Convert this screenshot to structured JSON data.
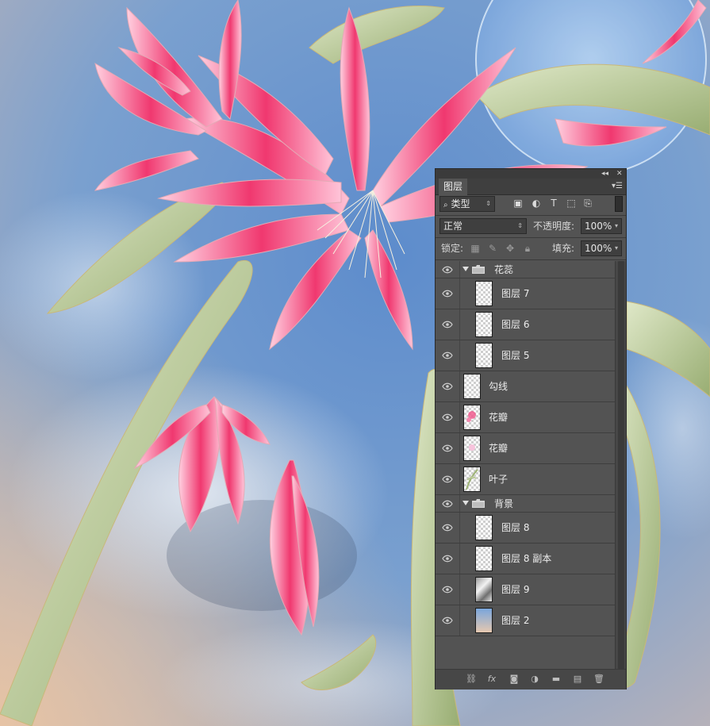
{
  "panel": {
    "tab_title": "图层",
    "collapse_icon": "double-chevron-left-icon",
    "close_icon": "close-icon",
    "menu_icon": "panel-menu-icon",
    "filter": {
      "search_icon": "search-icon",
      "value": "类型"
    },
    "filter_icons": [
      "image-filter-icon",
      "adjustment-filter-icon",
      "text-filter-icon",
      "shape-filter-icon",
      "smart-object-filter-icon"
    ],
    "blend_mode": "正常",
    "opacity_label": "不透明度:",
    "opacity_value": "100%",
    "lock_label": "锁定:",
    "lock_icons": [
      "lock-transparent-icon",
      "lock-paint-icon",
      "lock-position-icon",
      "lock-all-icon"
    ],
    "fill_label": "填充:",
    "fill_value": "100%",
    "layers": [
      {
        "name": "花蕊",
        "kind": "group",
        "expanded": true,
        "indent": 0
      },
      {
        "name": "图层 7",
        "kind": "layer",
        "indent": 1,
        "thumb": "transparent"
      },
      {
        "name": "图层 6",
        "kind": "layer",
        "indent": 1,
        "thumb": "transparent"
      },
      {
        "name": "图层 5",
        "kind": "layer",
        "indent": 1,
        "thumb": "transparent"
      },
      {
        "name": "勾线",
        "kind": "layer",
        "indent": 0,
        "thumb": "transparent"
      },
      {
        "name": "花瓣",
        "kind": "layer",
        "indent": 0,
        "thumb": "pink-flower"
      },
      {
        "name": "花瓣",
        "kind": "layer",
        "indent": 0,
        "thumb": "light-pink"
      },
      {
        "name": "叶子",
        "kind": "layer",
        "indent": 0,
        "thumb": "green-leaves"
      },
      {
        "name": "背景",
        "kind": "group",
        "expanded": true,
        "indent": 0
      },
      {
        "name": "图层 8",
        "kind": "layer",
        "indent": 1,
        "thumb": "transparent"
      },
      {
        "name": "图层 8 副本",
        "kind": "layer",
        "indent": 1,
        "thumb": "transparent"
      },
      {
        "name": "图层 9",
        "kind": "layer",
        "indent": 1,
        "thumb": "cloud-texture"
      },
      {
        "name": "图层 2",
        "kind": "layer",
        "indent": 1,
        "thumb": "sky-gradient"
      }
    ],
    "bottom_icons": [
      "link-layers-icon",
      "fx-icon",
      "add-mask-icon",
      "adjustment-layer-icon",
      "new-group-icon",
      "new-layer-icon",
      "delete-icon"
    ]
  },
  "colors": {
    "panel_bg": "#535353",
    "sky": "#4a76b3",
    "petal": "#f0538a",
    "leaf": "#a9bb84"
  }
}
